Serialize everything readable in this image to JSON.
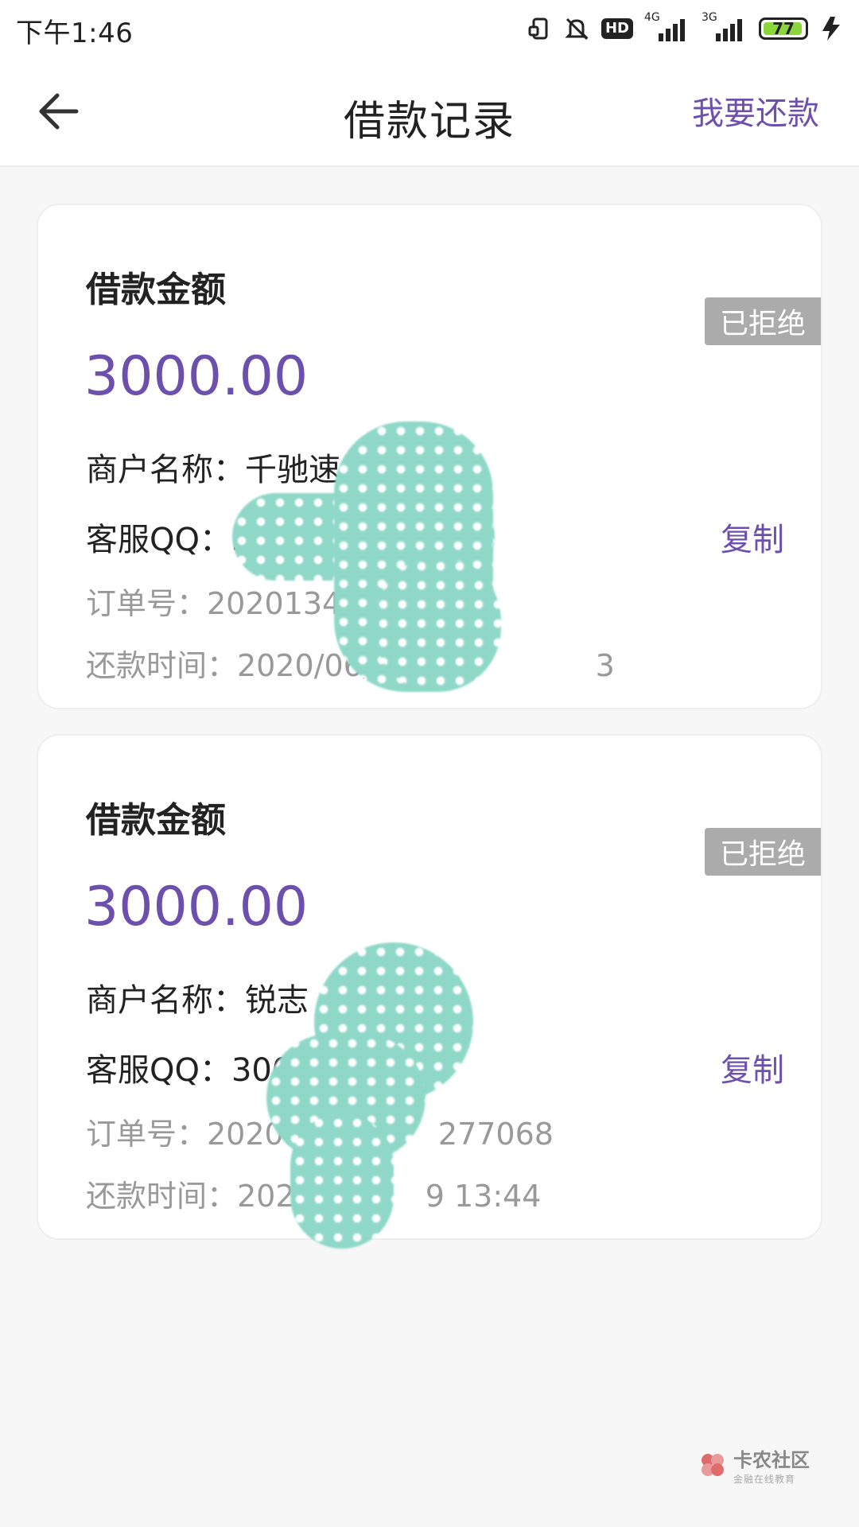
{
  "status_bar": {
    "time": "下午1:46",
    "hd_label": "HD",
    "network_1": "4G",
    "network_2": "3G",
    "battery": "77",
    "battery_color": "#8bd63a"
  },
  "header": {
    "title": "借款记录",
    "back_icon": "back-arrow-icon",
    "action_label": "我要还款"
  },
  "colors": {
    "accent": "#6d4fae",
    "badge_bg": "#ababab",
    "muted_text": "#999999"
  },
  "records": [
    {
      "amount_label": "借款金额",
      "amount": "3000.00",
      "status": "已拒绝",
      "merchant": "商户名称：千驰速",
      "qq": "客服QQ：3",
      "copy_label": "复制",
      "order_no": "订单号：20201343",
      "repay_time": "还款时间：2020/06/",
      "repay_time_tail": "3"
    },
    {
      "amount_label": "借款金额",
      "amount": "3000.00",
      "status": "已拒绝",
      "merchant": "商户名称：锐志",
      "qq": "客服QQ：300",
      "copy_label": "复制",
      "order_no": "订单号：20201",
      "order_no_tail": "277068",
      "repay_time": "还款时间：2020",
      "repay_time_tail": "9 13:44"
    }
  ],
  "watermark": {
    "name": "卡农社区",
    "subtitle": "金融在线教育"
  }
}
